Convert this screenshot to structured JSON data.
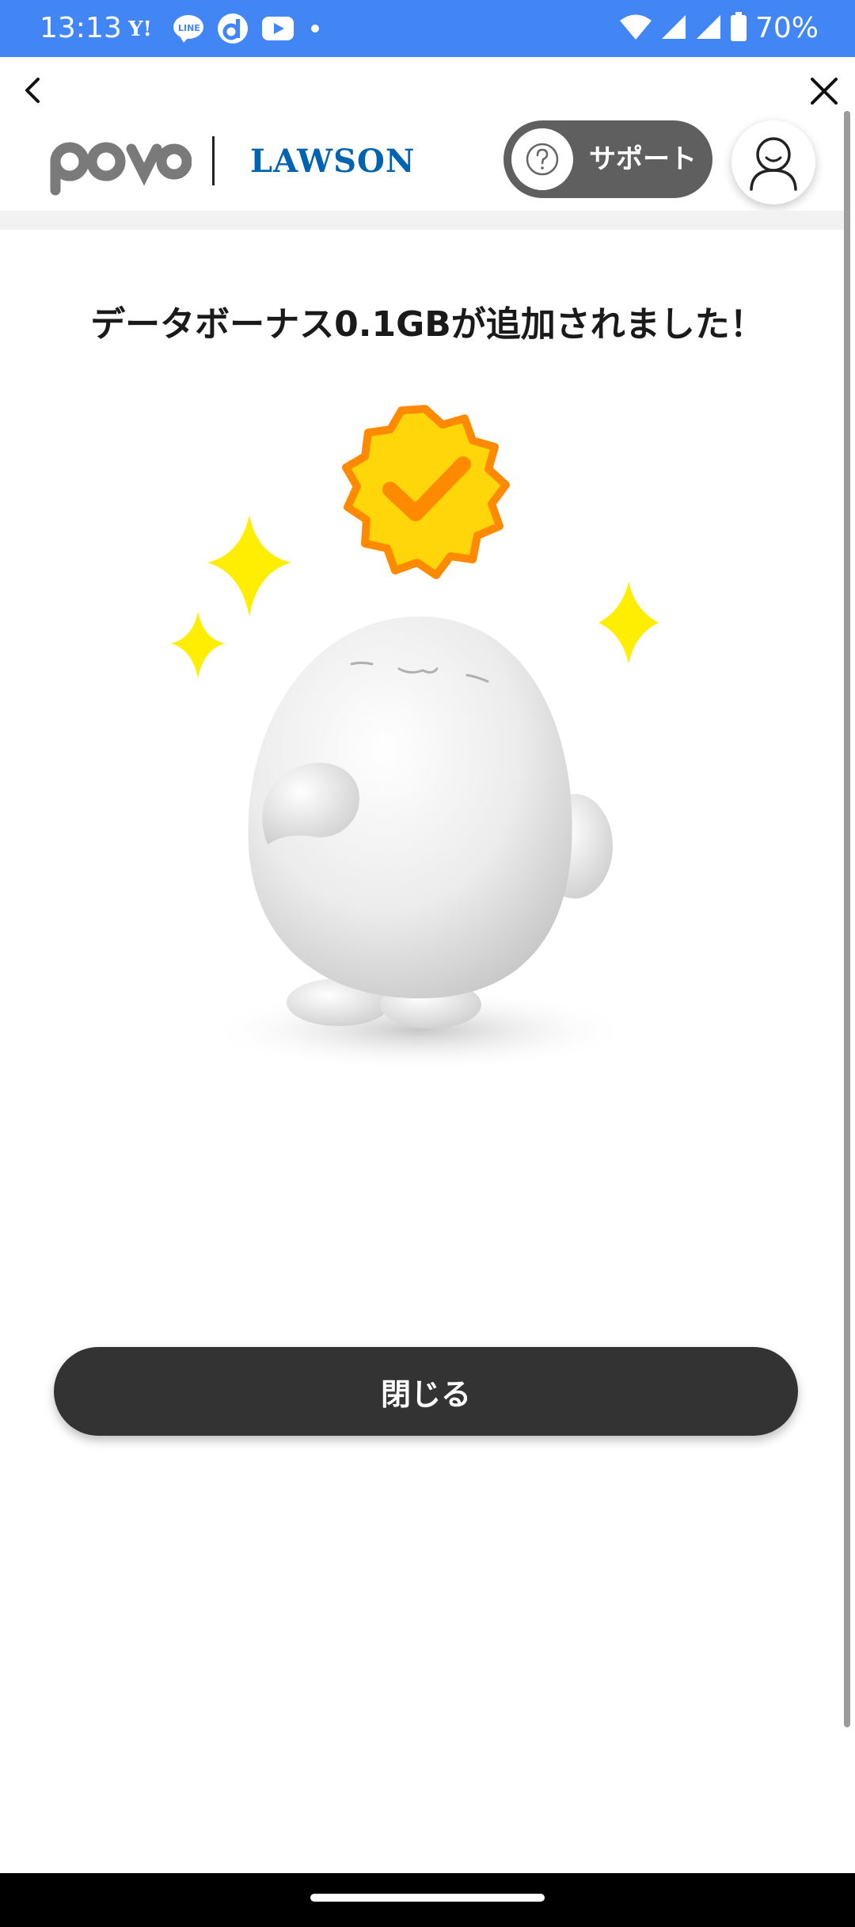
{
  "status_bar": {
    "time": "13:13",
    "battery": "70%",
    "app_icons": [
      "yahoo-icon",
      "line-icon",
      "d-icon",
      "youtube-icon",
      "dot-icon"
    ]
  },
  "header": {
    "brand_povo": "povo",
    "brand_lawson": "LAWSON",
    "support_label": "サポート"
  },
  "main": {
    "headline": "データボーナス0.1GBが追加されました！",
    "close_button_label": "閉じる"
  },
  "colors": {
    "status_bar": "#4285f4",
    "brand_lawson": "#0063b0",
    "support_button": "#5f5f5f",
    "close_button": "#333333",
    "sparkle": "#ffee00",
    "badge_fill": "#ffd60a",
    "badge_border": "#ff8a00"
  }
}
